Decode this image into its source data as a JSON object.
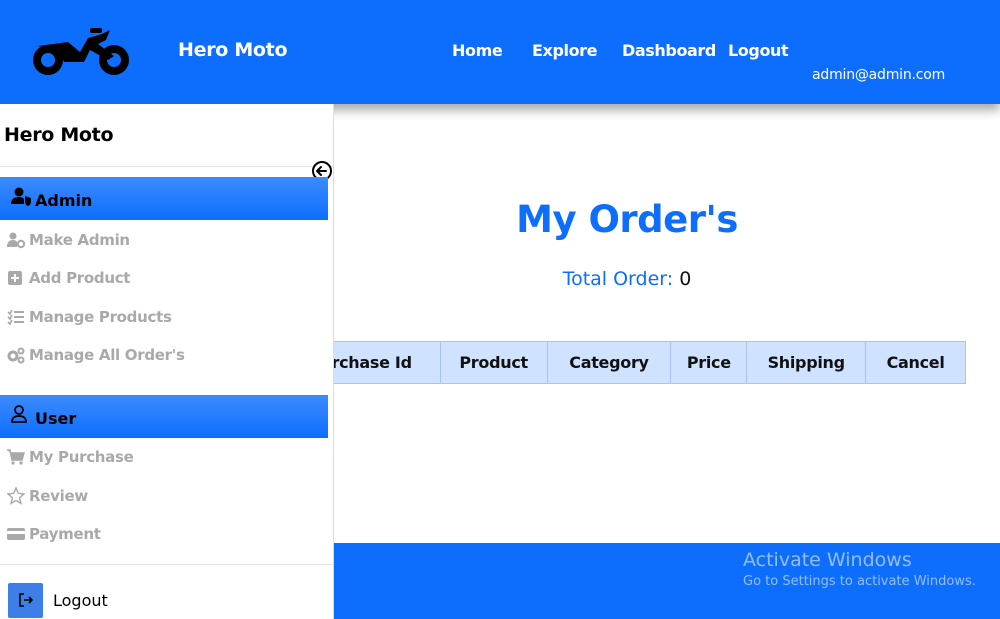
{
  "navbar": {
    "brand": "Hero Moto",
    "links": [
      "Home",
      "Explore",
      "Dashboard",
      "Logout"
    ],
    "email": "admin@admin.com"
  },
  "main": {
    "title": "My Order's",
    "total_label": "Total Order:",
    "total_value": "0",
    "table_headers": [
      "Purchase Id",
      "Product",
      "Category",
      "Price",
      "Shipping",
      "Cancel"
    ]
  },
  "drawer": {
    "title": "Hero Moto",
    "admin_section": "Admin",
    "admin_items": [
      "Make Admin",
      "Add Product",
      "Manage Products",
      "Manage All Order's"
    ],
    "user_section": "User",
    "user_items": [
      "My Purchase",
      "Review",
      "Payment"
    ],
    "logout": "Logout"
  },
  "watermark": {
    "title": "Activate Windows",
    "subtitle": "Go to Settings to activate Windows."
  },
  "colors": {
    "primary": "#0d6efd",
    "table_header_bg": "#cfe2ff",
    "muted_menu": "#a9a9a9"
  },
  "icons": [
    "motorcycle-icon",
    "user-shield-icon",
    "users-cog-icon",
    "plus-square-icon",
    "tasks-icon",
    "cogs-icon",
    "user-icon",
    "cart-icon",
    "star-icon",
    "credit-card-icon",
    "sign-out-icon",
    "arrow-left-circle-icon"
  ]
}
